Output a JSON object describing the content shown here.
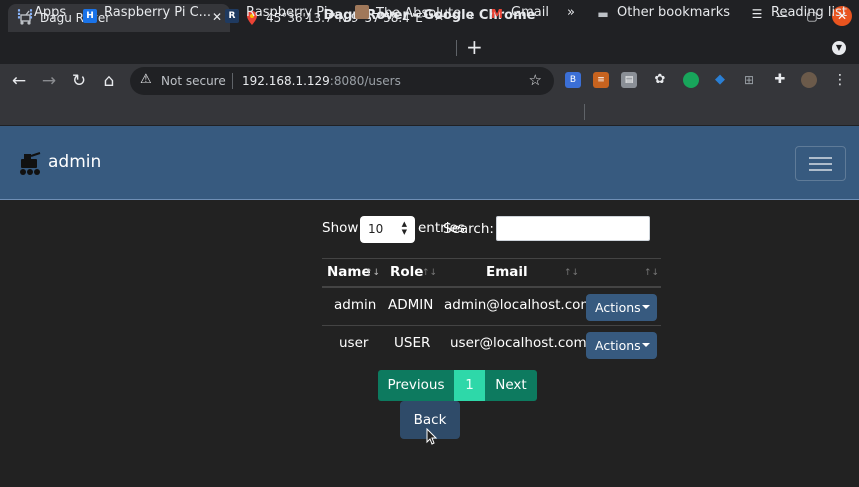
{
  "window": {
    "title": "Dagu Rover - Google Chrome"
  },
  "tabs": [
    {
      "label": "Dagu Rover",
      "icon": "rover-icon"
    },
    {
      "label": "45°36'13.7\"N 9°57'58.4\"E -",
      "icon": "map-pin-icon"
    }
  ],
  "toolbar": {
    "not_secure": "Not secure",
    "url_host": "192.168.1.129",
    "url_rest": ":8080/users"
  },
  "bookmarks": {
    "items": [
      {
        "label": "Apps",
        "icon": "apps-grid-icon"
      },
      {
        "label": "Raspberry Pi C...",
        "icon": "raspberry-bookmark-icon"
      },
      {
        "label": "Raspberry Pi...",
        "icon": "r-letter-icon"
      },
      {
        "label": "The Absolute...",
        "icon": "avatar-bookmark-icon"
      },
      {
        "label": "Gmail",
        "icon": "gmail-icon"
      }
    ],
    "more": "»",
    "other": "Other bookmarks",
    "reading": "Reading list"
  },
  "navbar": {
    "brand": "admin"
  },
  "datatable": {
    "show_label": "Show",
    "length_value": "10",
    "entries_label": "entries",
    "search_label": "Search:",
    "search_value": "",
    "columns": [
      "Name",
      "Role",
      "Email",
      ""
    ],
    "rows": [
      {
        "name": "admin",
        "role": "ADMIN",
        "email": "admin@localhost.com",
        "action": "Actions"
      },
      {
        "name": "user",
        "role": "USER",
        "email": "user@localhost.com",
        "action": "Actions"
      }
    ],
    "pagination": {
      "previous": "Previous",
      "page": "1",
      "next": "Next"
    }
  },
  "back_label": "Back",
  "colors": {
    "navbar": "#375a7f",
    "success": "#00bc8c",
    "body_bg": "#222222"
  }
}
